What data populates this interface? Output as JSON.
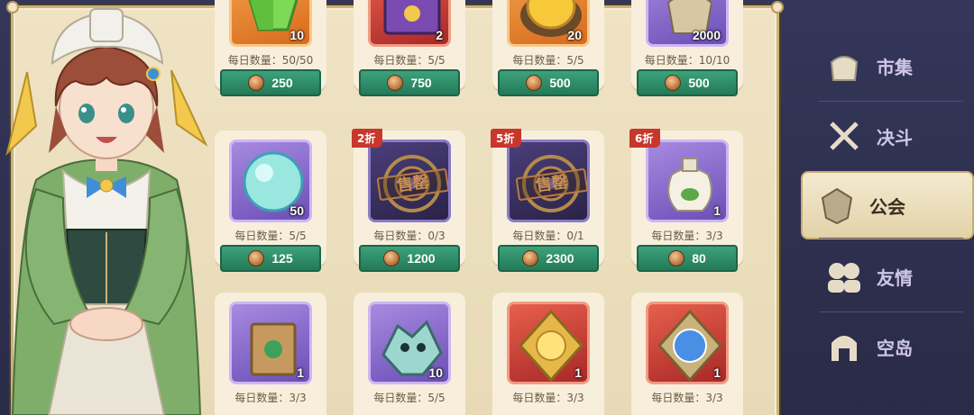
{
  "limit_prefix": "每日数量：",
  "shop_items": [
    {
      "qty": "10",
      "limit": "50/50",
      "price": "250",
      "bg": "orange",
      "icon": "green-crystal-icon",
      "discount": ""
    },
    {
      "qty": "2",
      "limit": "5/5",
      "price": "750",
      "bg": "red",
      "icon": "spellbook-icon",
      "discount": ""
    },
    {
      "qty": "20",
      "limit": "5/5",
      "price": "500",
      "bg": "orange",
      "icon": "gold-ore-icon",
      "discount": ""
    },
    {
      "qty": "2000",
      "limit": "10/10",
      "price": "500",
      "bg": "purple",
      "icon": "potion-pouch-icon",
      "discount": ""
    },
    {
      "qty": "50",
      "limit": "5/5",
      "price": "125",
      "bg": "purple",
      "icon": "water-orb-icon",
      "discount": ""
    },
    {
      "qty": "",
      "limit": "0/3",
      "price": "1200",
      "bg": "dark",
      "icon": "emblem-icon",
      "discount": "2折",
      "sold": "售罄"
    },
    {
      "qty": "",
      "limit": "0/1",
      "price": "2300",
      "bg": "dark",
      "icon": "emblem-icon",
      "discount": "5折",
      "sold": "售罄"
    },
    {
      "qty": "1",
      "limit": "3/3",
      "price": "80",
      "bg": "purple",
      "icon": "seed-bag-icon",
      "discount": "6折"
    },
    {
      "qty": "1",
      "limit": "3/3",
      "price": "",
      "bg": "purple",
      "icon": "paper-bag-icon",
      "discount": ""
    },
    {
      "qty": "10",
      "limit": "5/5",
      "price": "",
      "bg": "purple",
      "icon": "dragon-skull-icon",
      "discount": ""
    },
    {
      "qty": "1",
      "limit": "3/3",
      "price": "",
      "bg": "red",
      "icon": "golden-orb-icon",
      "discount": ""
    },
    {
      "qty": "1",
      "limit": "3/3",
      "price": "",
      "bg": "red",
      "icon": "blue-orb-icon",
      "discount": ""
    }
  ],
  "nav": [
    {
      "label": "市集",
      "icon": "bag-icon",
      "active": false
    },
    {
      "label": "决斗",
      "icon": "crossed-swords-icon",
      "active": false
    },
    {
      "label": "公会",
      "icon": "guild-crest-icon",
      "active": true
    },
    {
      "label": "友情",
      "icon": "friends-icon",
      "active": false
    },
    {
      "label": "空岛",
      "icon": "helmet-icon",
      "active": false
    }
  ],
  "colors": {
    "parchment": "#efe3c4",
    "price_button": "#2e8d68",
    "discount_tag": "#c8362c",
    "nav_background": "#2b2d4a",
    "nav_active": "#f4ead0"
  }
}
